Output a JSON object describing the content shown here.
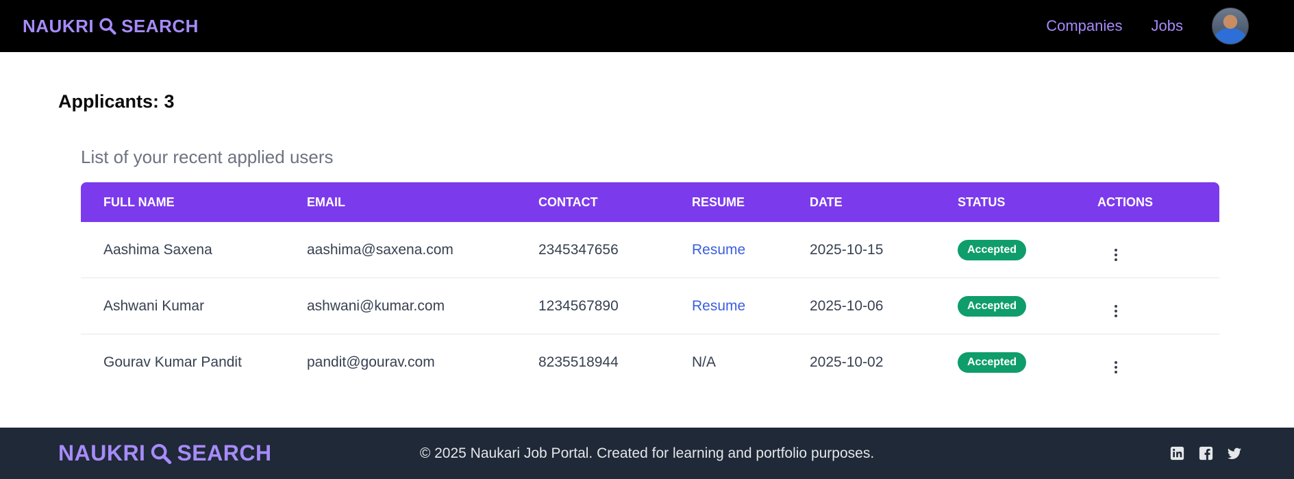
{
  "header": {
    "logo_left": "NAUKRI",
    "logo_right": "SEARCH",
    "nav": {
      "companies": "Companies",
      "jobs": "Jobs"
    }
  },
  "main": {
    "applicants_title": "Applicants: 3",
    "caption": "List of your recent applied users",
    "columns": [
      "FULL NAME",
      "EMAIL",
      "CONTACT",
      "RESUME",
      "DATE",
      "STATUS",
      "ACTIONS"
    ],
    "rows": [
      {
        "name": "Aashima Saxena",
        "email": "aashima@saxena.com",
        "contact": "2345347656",
        "resume": "Resume",
        "date": "2025-10-15",
        "status": "Accepted"
      },
      {
        "name": "Ashwani Kumar",
        "email": "ashwani@kumar.com",
        "contact": "1234567890",
        "resume": "Resume",
        "date": "2025-10-06",
        "status": "Accepted"
      },
      {
        "name": "Gourav Kumar Pandit",
        "email": "pandit@gourav.com",
        "contact": "8235518944",
        "resume": "N/A",
        "date": "2025-10-02",
        "status": "Accepted"
      }
    ]
  },
  "footer": {
    "logo_left": "NAUKRI",
    "logo_right": "SEARCH",
    "copyright": "© 2025 Naukari Job Portal. Created for learning and portfolio purposes.",
    "socials": [
      "linkedin-icon",
      "facebook-icon",
      "twitter-icon"
    ]
  },
  "colors": {
    "accent": "#a78bfa",
    "table_header": "#7c3aed",
    "status_accepted": "#0f9d6b",
    "link": "#3b5ee0",
    "footer_bg": "#1f2937"
  }
}
